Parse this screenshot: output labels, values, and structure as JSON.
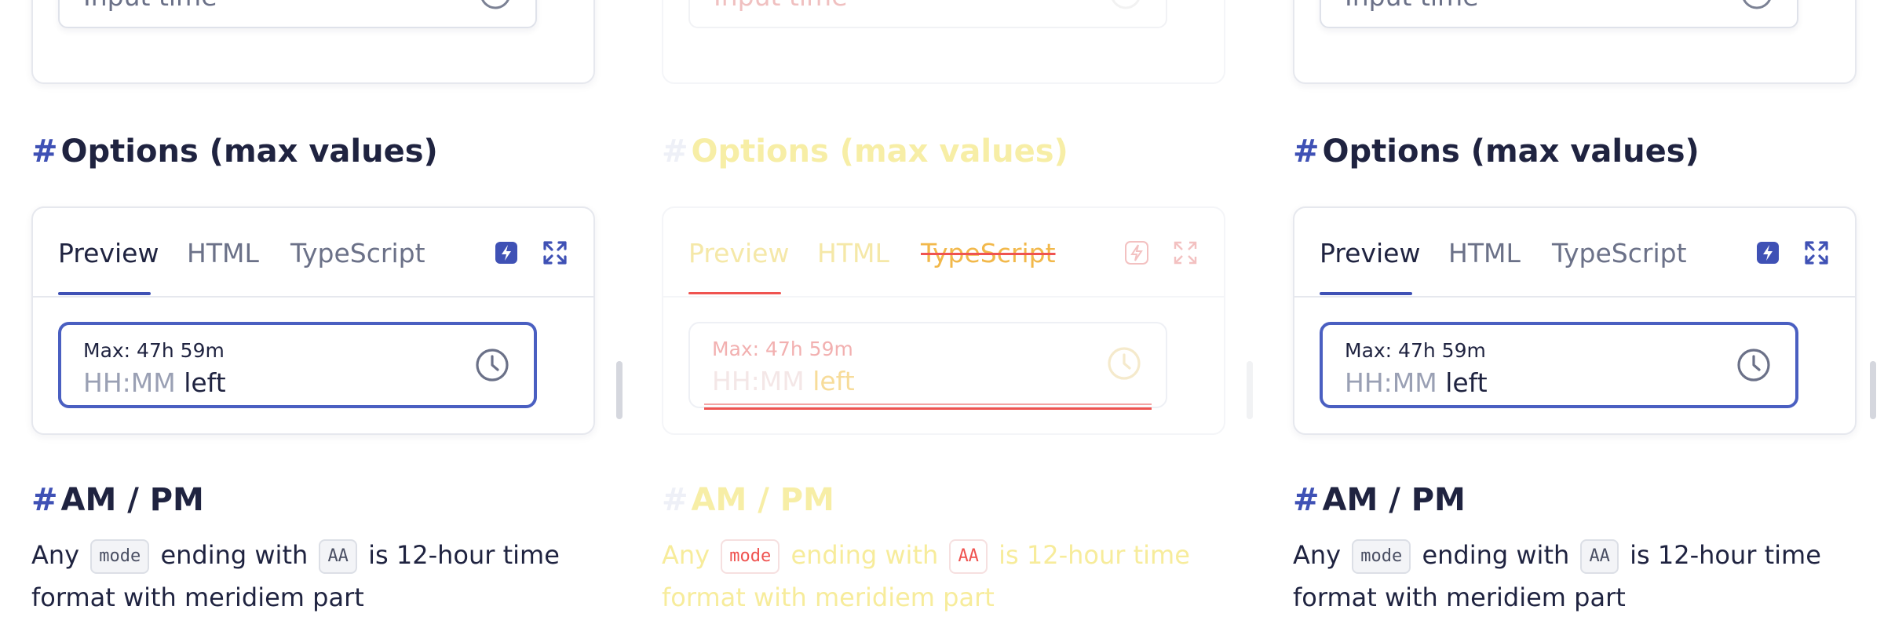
{
  "colors": {
    "accent": "#3f51b5",
    "text": "#1f2340",
    "muted": "#6b7188",
    "diff_red": "#ef5350",
    "diff_yellow": "#f7ec9b"
  },
  "panels": [
    {
      "variant": "normal",
      "input": {
        "placeholder": "Input time",
        "icon": "check-circle-icon"
      },
      "heading_options": {
        "hash": "#",
        "text": "Options (max values)"
      },
      "tabs": [
        "Preview",
        "HTML",
        "TypeScript"
      ],
      "tool_icons": [
        "bolt-icon",
        "expand-icon"
      ],
      "time_field": {
        "label": "Max: 47h 59m",
        "mask": "HH:MM",
        "suffix": "left",
        "icon": "clock-icon"
      },
      "heading_ampm": {
        "hash": "#",
        "text": "AM / PM"
      },
      "paragraph": {
        "t1": "Any",
        "code1": "mode",
        "t2": "ending with",
        "code2": "AA",
        "t3": "is 12-hour time format with meridiem part"
      }
    },
    {
      "variant": "diff",
      "input": {
        "placeholder": "Input time",
        "icon": "check-circle-icon"
      },
      "heading_options": {
        "hash": "#",
        "text": "Options (max values)"
      },
      "tabs": [
        "Preview",
        "HTML",
        "TypeScript"
      ],
      "tool_icons": [
        "bolt-icon",
        "expand-icon"
      ],
      "time_field": {
        "label": "Max: 47h 59m",
        "mask": "HH:MM",
        "suffix": "left",
        "icon": "clock-icon"
      },
      "heading_ampm": {
        "hash": "#",
        "text": "AM / PM"
      },
      "paragraph": {
        "t1": "Any",
        "code1": "mode",
        "t2": "ending with",
        "code2": "AA",
        "t3": "is 12-hour time format with meridiem part"
      }
    },
    {
      "variant": "normal",
      "input": {
        "placeholder": "Input time",
        "icon": "check-circle-icon"
      },
      "heading_options": {
        "hash": "#",
        "text": "Options (max values)"
      },
      "tabs": [
        "Preview",
        "HTML",
        "TypeScript"
      ],
      "tool_icons": [
        "bolt-icon",
        "expand-icon"
      ],
      "time_field": {
        "label": "Max: 47h 59m",
        "mask": "HH:MM",
        "suffix": "left",
        "icon": "clock-icon"
      },
      "heading_ampm": {
        "hash": "#",
        "text": "AM / PM"
      },
      "paragraph": {
        "t1": "Any",
        "code1": "mode",
        "t2": "ending with",
        "code2": "AA",
        "t3": "is 12-hour time format with meridiem part"
      }
    }
  ]
}
